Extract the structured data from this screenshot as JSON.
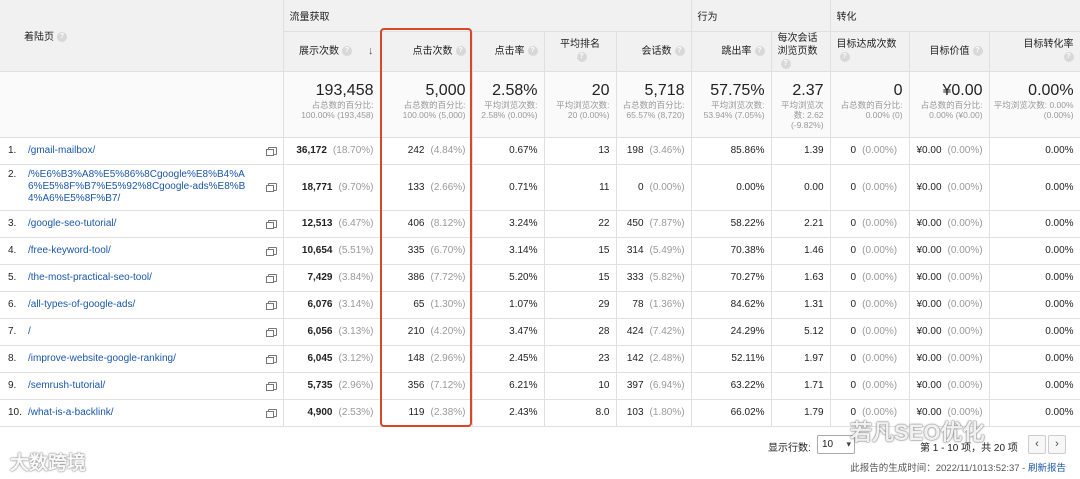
{
  "groups": {
    "acquisition": "流量获取",
    "behavior": "行为",
    "conversion": "转化"
  },
  "columns": {
    "landing_page": "着陆页",
    "impressions": "展示次数",
    "clicks": "点击次数",
    "ctr": "点击率",
    "avg_position": "平均排名",
    "sessions": "会话数",
    "bounce_rate": "跳出率",
    "pages_per_session": "每次会话浏览页数",
    "goal_completions": "目标达成次数",
    "goal_value": "目标价值",
    "goal_conv_rate": "目标转化率"
  },
  "help_icon": "?",
  "sort_icon": "↓",
  "totals": {
    "impressions": "193,458",
    "impressions_sub": "占总数的百分比: 100.00% (193,458)",
    "clicks": "5,000",
    "clicks_sub": "占总数的百分比: 100.00% (5,000)",
    "ctr": "2.58%",
    "ctr_sub": "平均浏览次数: 2.58% (0.00%)",
    "avg_position": "20",
    "avg_position_sub": "平均浏览次数: 20 (0.00%)",
    "sessions": "5,718",
    "sessions_sub": "占总数的百分比: 65.57% (8,720)",
    "bounce_rate": "57.75%",
    "bounce_rate_sub": "平均浏览次数: 53.94% (7.05%)",
    "pages_per_session": "2.37",
    "pages_per_session_sub": "平均浏览次数: 2.62 (-9.82%)",
    "goal_completions": "0",
    "goal_completions_sub": "占总数的百分比: 0.00% (0)",
    "goal_value": "¥0.00",
    "goal_value_sub": "占总数的百分比: 0.00% (¥0.00)",
    "goal_conv_rate": "0.00%",
    "goal_conv_rate_sub": "平均浏览次数: 0.00% (0.00%)"
  },
  "rows": [
    {
      "idx": "1.",
      "page": "/gmail-mailbox/",
      "impressions": "36,172",
      "imp_pct": "(18.70%)",
      "clicks": "242",
      "clk_pct": "(4.84%)",
      "ctr": "0.67%",
      "pos": "13",
      "sessions": "198",
      "ses_pct": "(3.46%)",
      "bounce": "85.86%",
      "pps": "1.39",
      "goals": "0",
      "goals_pct": "(0.00%)",
      "value": "¥0.00",
      "value_pct": "(0.00%)",
      "conv": "0.00%"
    },
    {
      "idx": "2.",
      "page": "/%E6%B3%A8%E5%86%8Cgoogle%E8%B4%A6%E5%8F%B7%E5%92%8Cgoogle-ads%E8%B4%A6%E5%8F%B7/",
      "impressions": "18,771",
      "imp_pct": "(9.70%)",
      "clicks": "133",
      "clk_pct": "(2.66%)",
      "ctr": "0.71%",
      "pos": "11",
      "sessions": "0",
      "ses_pct": "(0.00%)",
      "bounce": "0.00%",
      "pps": "0.00",
      "goals": "0",
      "goals_pct": "(0.00%)",
      "value": "¥0.00",
      "value_pct": "(0.00%)",
      "conv": "0.00%"
    },
    {
      "idx": "3.",
      "page": "/google-seo-tutorial/",
      "impressions": "12,513",
      "imp_pct": "(6.47%)",
      "clicks": "406",
      "clk_pct": "(8.12%)",
      "ctr": "3.24%",
      "pos": "22",
      "sessions": "450",
      "ses_pct": "(7.87%)",
      "bounce": "58.22%",
      "pps": "2.21",
      "goals": "0",
      "goals_pct": "(0.00%)",
      "value": "¥0.00",
      "value_pct": "(0.00%)",
      "conv": "0.00%"
    },
    {
      "idx": "4.",
      "page": "/free-keyword-tool/",
      "impressions": "10,654",
      "imp_pct": "(5.51%)",
      "clicks": "335",
      "clk_pct": "(6.70%)",
      "ctr": "3.14%",
      "pos": "15",
      "sessions": "314",
      "ses_pct": "(5.49%)",
      "bounce": "70.38%",
      "pps": "1.46",
      "goals": "0",
      "goals_pct": "(0.00%)",
      "value": "¥0.00",
      "value_pct": "(0.00%)",
      "conv": "0.00%"
    },
    {
      "idx": "5.",
      "page": "/the-most-practical-seo-tool/",
      "impressions": "7,429",
      "imp_pct": "(3.84%)",
      "clicks": "386",
      "clk_pct": "(7.72%)",
      "ctr": "5.20%",
      "pos": "15",
      "sessions": "333",
      "ses_pct": "(5.82%)",
      "bounce": "70.27%",
      "pps": "1.63",
      "goals": "0",
      "goals_pct": "(0.00%)",
      "value": "¥0.00",
      "value_pct": "(0.00%)",
      "conv": "0.00%"
    },
    {
      "idx": "6.",
      "page": "/all-types-of-google-ads/",
      "impressions": "6,076",
      "imp_pct": "(3.14%)",
      "clicks": "65",
      "clk_pct": "(1.30%)",
      "ctr": "1.07%",
      "pos": "29",
      "sessions": "78",
      "ses_pct": "(1.36%)",
      "bounce": "84.62%",
      "pps": "1.31",
      "goals": "0",
      "goals_pct": "(0.00%)",
      "value": "¥0.00",
      "value_pct": "(0.00%)",
      "conv": "0.00%"
    },
    {
      "idx": "7.",
      "page": "/",
      "impressions": "6,056",
      "imp_pct": "(3.13%)",
      "clicks": "210",
      "clk_pct": "(4.20%)",
      "ctr": "3.47%",
      "pos": "28",
      "sessions": "424",
      "ses_pct": "(7.42%)",
      "bounce": "24.29%",
      "pps": "5.12",
      "goals": "0",
      "goals_pct": "(0.00%)",
      "value": "¥0.00",
      "value_pct": "(0.00%)",
      "conv": "0.00%"
    },
    {
      "idx": "8.",
      "page": "/improve-website-google-ranking/",
      "impressions": "6,045",
      "imp_pct": "(3.12%)",
      "clicks": "148",
      "clk_pct": "(2.96%)",
      "ctr": "2.45%",
      "pos": "23",
      "sessions": "142",
      "ses_pct": "(2.48%)",
      "bounce": "52.11%",
      "pps": "1.97",
      "goals": "0",
      "goals_pct": "(0.00%)",
      "value": "¥0.00",
      "value_pct": "(0.00%)",
      "conv": "0.00%"
    },
    {
      "idx": "9.",
      "page": "/semrush-tutorial/",
      "impressions": "5,735",
      "imp_pct": "(2.96%)",
      "clicks": "356",
      "clk_pct": "(7.12%)",
      "ctr": "6.21%",
      "pos": "10",
      "sessions": "397",
      "ses_pct": "(6.94%)",
      "bounce": "63.22%",
      "pps": "1.71",
      "goals": "0",
      "goals_pct": "(0.00%)",
      "value": "¥0.00",
      "value_pct": "(0.00%)",
      "conv": "0.00%"
    },
    {
      "idx": "10.",
      "page": "/what-is-a-backlink/",
      "impressions": "4,900",
      "imp_pct": "(2.53%)",
      "clicks": "119",
      "clk_pct": "(2.38%)",
      "ctr": "2.43%",
      "pos": "8.0",
      "sessions": "103",
      "ses_pct": "(1.80%)",
      "bounce": "66.02%",
      "pps": "1.79",
      "goals": "0",
      "goals_pct": "(0.00%)",
      "value": "¥0.00",
      "value_pct": "(0.00%)",
      "conv": "0.00%"
    }
  ],
  "footer": {
    "rows_label": "显示行数:",
    "rows_value": "10",
    "pager_text": "第 1 - 10 项，共 20 项",
    "prev": "‹",
    "next": "›",
    "generated": "此报告的生成时间：2022/11/1013:52:37 - ",
    "refresh": "刷新报告"
  },
  "watermarks": {
    "left": "大数跨境",
    "right": "若凡SEO优化"
  },
  "colors": {
    "highlight_border": "#d9472b",
    "link": "#1a56a8",
    "header_bg": "#f1f1f1"
  }
}
